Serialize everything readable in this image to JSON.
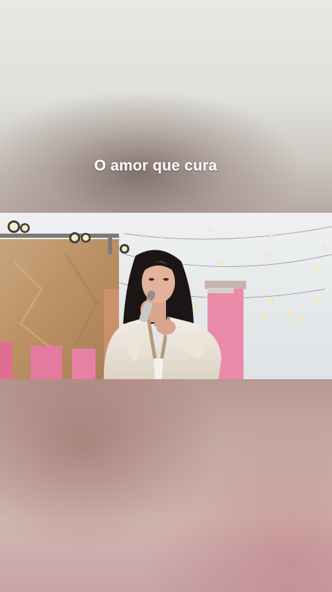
{
  "caption": {
    "text": "O amor que cura"
  },
  "video": {
    "scene": "stage-performance"
  },
  "colors": {
    "sky": "#e9ecec",
    "stage_wood": "#c7a27a",
    "stage_pink": "#e37aa0",
    "hair": "#1a1514",
    "outfit": "#ece6dd",
    "caption_text": "#ffffff"
  }
}
